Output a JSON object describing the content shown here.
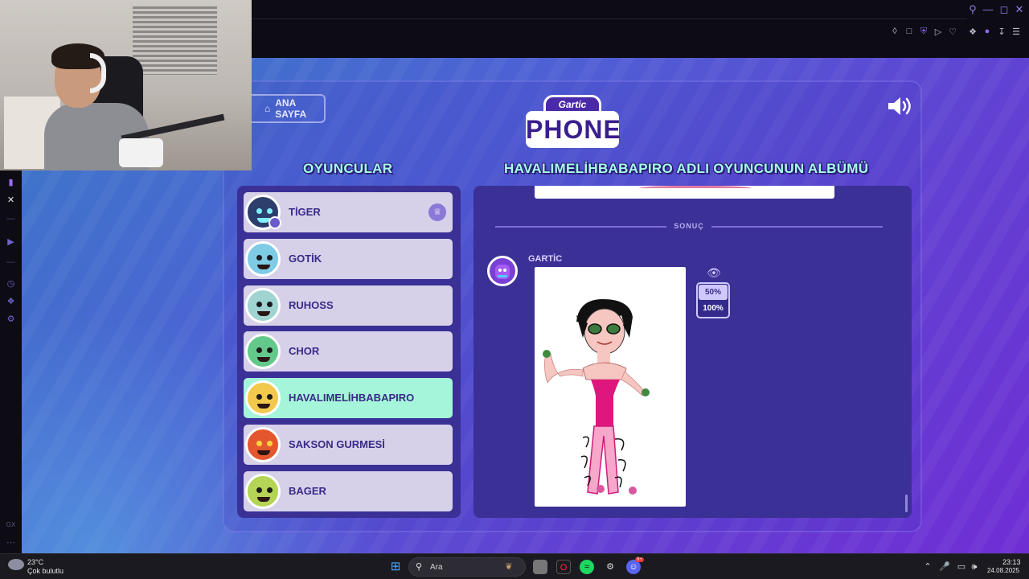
{
  "game": {
    "home_button": "ANA SAYFA",
    "logo_top": "Gartic",
    "logo_main": "PHONE",
    "players_heading": "OYUNCULAR",
    "album_heading": "HAVALIMELİHBABAPIRO ADLI OYUNCUNUN ALBÜMÜ",
    "players": [
      {
        "name": "TİGER",
        "avatar_color": "#2c3e6b",
        "owner": true
      },
      {
        "name": "GOTİK",
        "avatar_color": "#7ecbe6",
        "owner": false
      },
      {
        "name": "RUHOSS",
        "avatar_color": "#9fd4d2",
        "owner": false
      },
      {
        "name": "CHOR",
        "avatar_color": "#62c98a",
        "owner": false
      },
      {
        "name": "HAVALIMELİHBABAPIRO",
        "avatar_color": "#f2c94c",
        "owner": false,
        "active": true
      },
      {
        "name": "SAKSON GURMESİ",
        "avatar_color": "#e4572e",
        "owner": false
      },
      {
        "name": "BAGER",
        "avatar_color": "#b4d455",
        "owner": false
      }
    ],
    "divider_label": "SONUÇ",
    "author_name": "GARTİC",
    "zoom_options": [
      "50%",
      "100%"
    ],
    "zoom_selected": "50%"
  },
  "taskbar": {
    "weather_temp": "23°C",
    "weather_desc": "Çok bulutlu",
    "search_placeholder": "Ara",
    "time": "23:13",
    "date": "24.08.2025",
    "discord_badge": "9+"
  },
  "colors": {
    "heading": "#a6ffe8",
    "active_player": "#a4f5d9",
    "player_row": "#d6d1e9",
    "panel": "#3a3095"
  }
}
